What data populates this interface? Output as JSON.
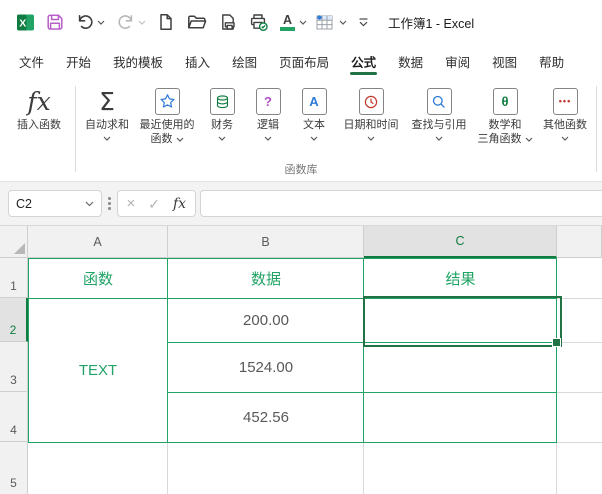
{
  "titlebar": {
    "title": "工作簿1 - Excel"
  },
  "tabs": [
    {
      "label": "文件"
    },
    {
      "label": "开始"
    },
    {
      "label": "我的模板"
    },
    {
      "label": "插入"
    },
    {
      "label": "绘图"
    },
    {
      "label": "页面布局"
    },
    {
      "label": "公式",
      "active": true
    },
    {
      "label": "数据"
    },
    {
      "label": "审阅"
    },
    {
      "label": "视图"
    },
    {
      "label": "帮助"
    }
  ],
  "ribbon": {
    "group_label": "函数库",
    "items": [
      {
        "name": "insert-function",
        "label": "插入函数"
      },
      {
        "name": "autosum",
        "label": "自动求和"
      },
      {
        "name": "recently-used",
        "line1": "最近使用的",
        "line2": "函数"
      },
      {
        "name": "financial",
        "label": "财务"
      },
      {
        "name": "logical",
        "label": "逻辑"
      },
      {
        "name": "text",
        "label": "文本"
      },
      {
        "name": "date-time",
        "label": "日期和时间"
      },
      {
        "name": "lookup-reference",
        "label": "查找与引用"
      },
      {
        "name": "math-trig",
        "line1": "数学和",
        "line2": "三角函数"
      },
      {
        "name": "more-functions",
        "label": "其他函数"
      }
    ]
  },
  "glyphs": {
    "logo_x": "X",
    "fx": "fx",
    "fx_small": "fx",
    "sigma": "Σ",
    "font_a": "A",
    "question": "?",
    "text_a": "A",
    "theta": "θ",
    "dots": "•••",
    "cancel": "×",
    "check": "✓"
  },
  "formula_bar": {
    "name_box": "C2",
    "formula": ""
  },
  "sheet": {
    "columns": [
      "A",
      "B",
      "C"
    ],
    "rows": [
      "1",
      "2",
      "3",
      "4",
      "5"
    ],
    "selection": "C2",
    "cells": {
      "A1": "函数",
      "B1": "数据",
      "C1": "结果",
      "A2": "TEXT",
      "B2": "200.00",
      "B3": "1524.00",
      "B4": "452.56"
    }
  },
  "colors": {
    "excel_green": "#107C41",
    "table_border_green": "#21A366",
    "selection_green": "#217346",
    "save_purple": "#B95FC9",
    "blue": "#2F7BD8",
    "red": "#C0392B",
    "number_text": "#595959"
  },
  "icons": [
    "excel-logo",
    "save-icon",
    "undo-icon",
    "redo-icon",
    "new-file-icon",
    "open-folder-icon",
    "print-preview-icon",
    "quick-print-icon",
    "font-color-icon",
    "freeze-panes-icon",
    "qat-overflow-icon",
    "fx-icon",
    "sigma-icon",
    "star-book-icon",
    "coins-book-icon",
    "question-book-icon",
    "text-book-icon",
    "clock-book-icon",
    "search-book-icon",
    "theta-book-icon",
    "more-book-icon",
    "chevron-down-icon",
    "cancel-icon",
    "enter-icon",
    "select-all-triangle",
    "fill-handle"
  ]
}
